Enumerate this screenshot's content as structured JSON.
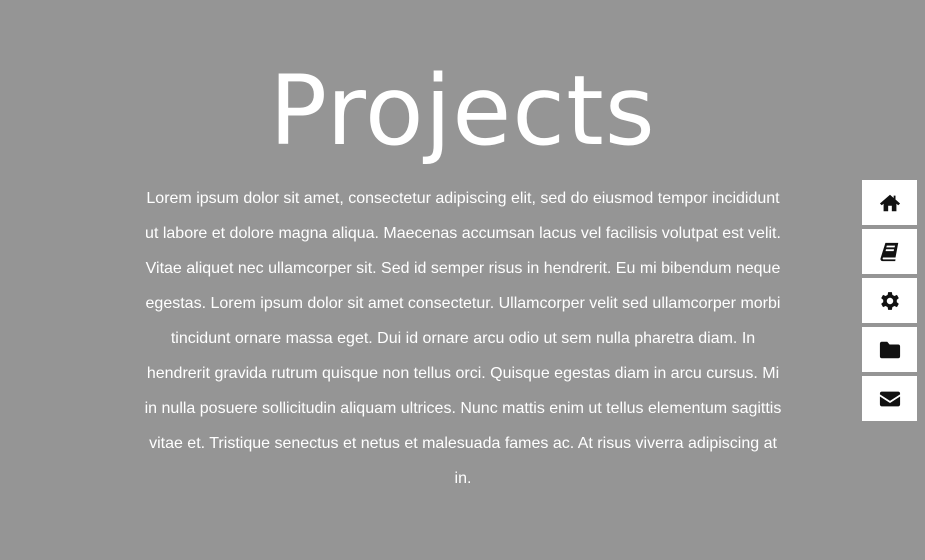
{
  "page": {
    "title": "Projects",
    "body": "Lorem ipsum dolor sit amet, consectetur adipiscing elit, sed do eiusmod tempor incididunt ut labore et dolore magna aliqua. Maecenas accumsan lacus vel facilisis volutpat est velit. Vitae aliquet nec ullamcorper sit. Sed id semper risus in hendrerit. Eu mi bibendum neque egestas. Lorem ipsum dolor sit amet consectetur. Ullamcorper velit sed ullamcorper morbi tincidunt ornare massa eget. Dui id ornare arcu odio ut sem nulla pharetra diam. In hendrerit gravida rutrum quisque non tellus orci. Quisque egestas diam in arcu cursus. Mi in nulla posuere sollicitudin aliquam ultrices. Nunc mattis enim ut tellus elementum sagittis vitae et. Tristique senectus et netus et malesuada fames ac. At risus viverra adipiscing at in."
  },
  "nav": {
    "items": [
      {
        "icon": "home-icon"
      },
      {
        "icon": "book-icon"
      },
      {
        "icon": "gear-icon"
      },
      {
        "icon": "folder-icon"
      },
      {
        "icon": "envelope-icon"
      }
    ]
  },
  "colors": {
    "background": "#959595",
    "text": "#ffffff",
    "nav_button": "#ffffff",
    "icon": "#111111"
  }
}
